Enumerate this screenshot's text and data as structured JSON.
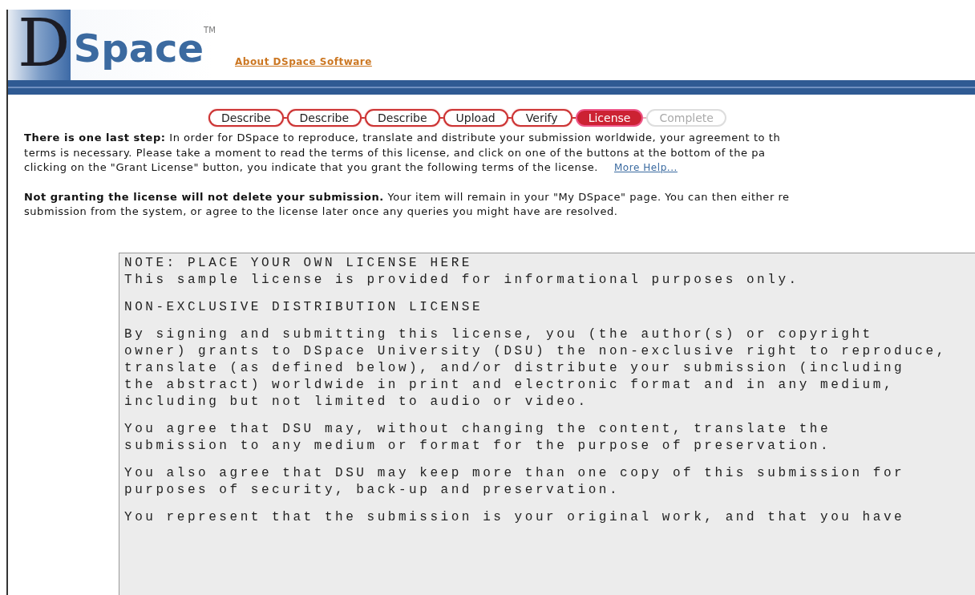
{
  "header": {
    "logo_letter": "D",
    "logo_word": "Space",
    "logo_mark": "TM",
    "link": "About DSpace Software"
  },
  "steps": [
    {
      "label": "Describe",
      "selected": false,
      "disabled": false
    },
    {
      "label": "Describe",
      "selected": false,
      "disabled": false
    },
    {
      "label": "Describe",
      "selected": false,
      "disabled": false
    },
    {
      "label": "Upload",
      "selected": false,
      "disabled": false
    },
    {
      "label": "Verify",
      "selected": false,
      "disabled": false
    },
    {
      "label": "License",
      "selected": true,
      "disabled": false
    },
    {
      "label": "Complete",
      "selected": false,
      "disabled": true
    }
  ],
  "intro": {
    "lines": [
      "**There is one last step:** In order for DSpace to reproduce, translate and distribute your submission worldwide, your agreement to th",
      "terms is necessary. Please take a moment to read the terms of this license, and click on one of the buttons at the bottom of the pa",
      "clicking on the \"Grant License\" button, you indicate that you grant the following terms of the license."
    ],
    "help_link": "More Help..."
  },
  "notice": {
    "lines": [
      "**Not granting the license will not delete your submission.** Your item will remain in your \"My DSpace\" page. You can then either re",
      "submission from the system, or agree to the license later once any queries you might have are resolved."
    ]
  },
  "license_text": [
    "NOTE: PLACE YOUR OWN LICENSE HERE\nThis sample license is provided for informational purposes only.",
    "NON-EXCLUSIVE DISTRIBUTION LICENSE",
    "By signing and submitting this license, you (the author(s) or copyright\nowner) grants to DSpace University (DSU) the non-exclusive right to reproduce,\ntranslate (as defined below), and/or distribute your submission (including\nthe abstract) worldwide in print and electronic format and in any medium,\nincluding but not limited to audio or video.",
    "You agree that DSU may, without changing the content, translate the\nsubmission to any medium or format for the purpose of preservation.",
    "You also agree that DSU may keep more than one copy of this submission for\npurposes of security, back-up and preservation.",
    "You represent that the submission is your original work, and that you have"
  ]
}
